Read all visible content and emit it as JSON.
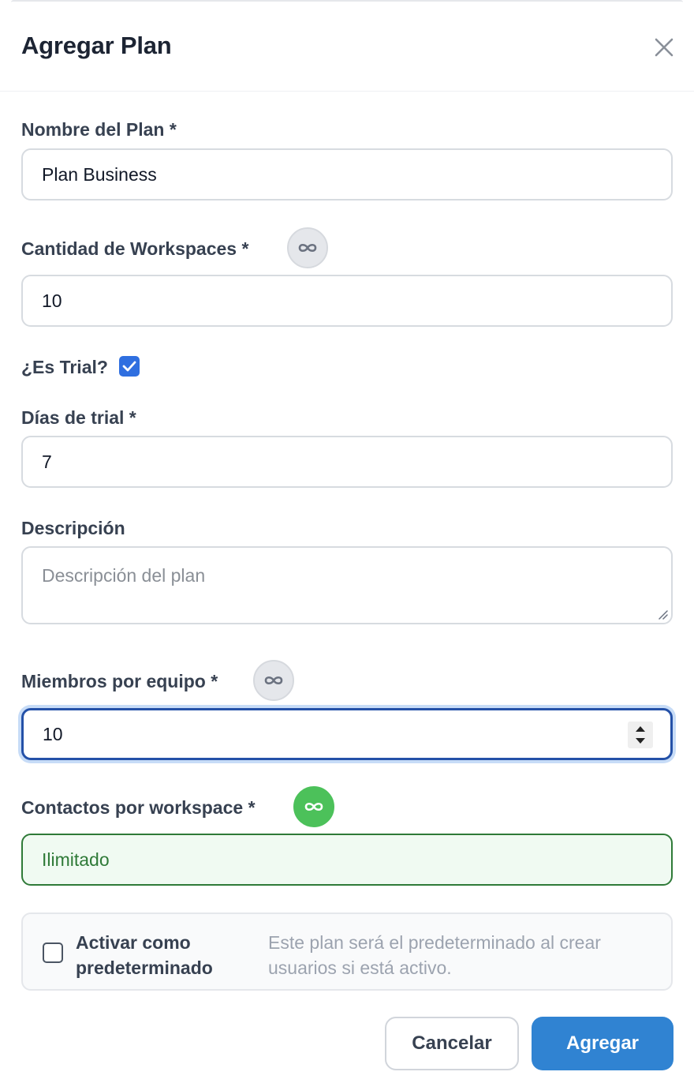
{
  "modal": {
    "title": "Agregar Plan"
  },
  "fields": {
    "plan_name": {
      "label": "Nombre del Plan *",
      "value": "Plan Business"
    },
    "workspaces": {
      "label": "Cantidad de Workspaces *",
      "value": "10"
    },
    "trial": {
      "label": "¿Es Trial?",
      "checked": true
    },
    "trial_days": {
      "label": "Días de trial *",
      "value": "7"
    },
    "description": {
      "label": "Descripción",
      "placeholder": "Descripción del plan"
    },
    "members": {
      "label": "Miembros por equipo *",
      "value": "10"
    },
    "contacts": {
      "label": "Contactos por workspace *",
      "value": "Ilimitado"
    }
  },
  "default_option": {
    "label": "Activar como predeterminado",
    "help": "Este plan será el predeterminado al crear usuarios si está activo.",
    "checked": false
  },
  "actions": {
    "cancel_label": "Cancelar",
    "submit_label": "Agregar"
  },
  "icons": {
    "close": "close-icon",
    "infinity": "infinity-icon",
    "check": "check-icon"
  },
  "colors": {
    "primary": "#3083d2",
    "focus": "#2451a8",
    "success": "#4cc15a",
    "success_text": "#2f7a38",
    "checkbox": "#2f6fe0"
  }
}
